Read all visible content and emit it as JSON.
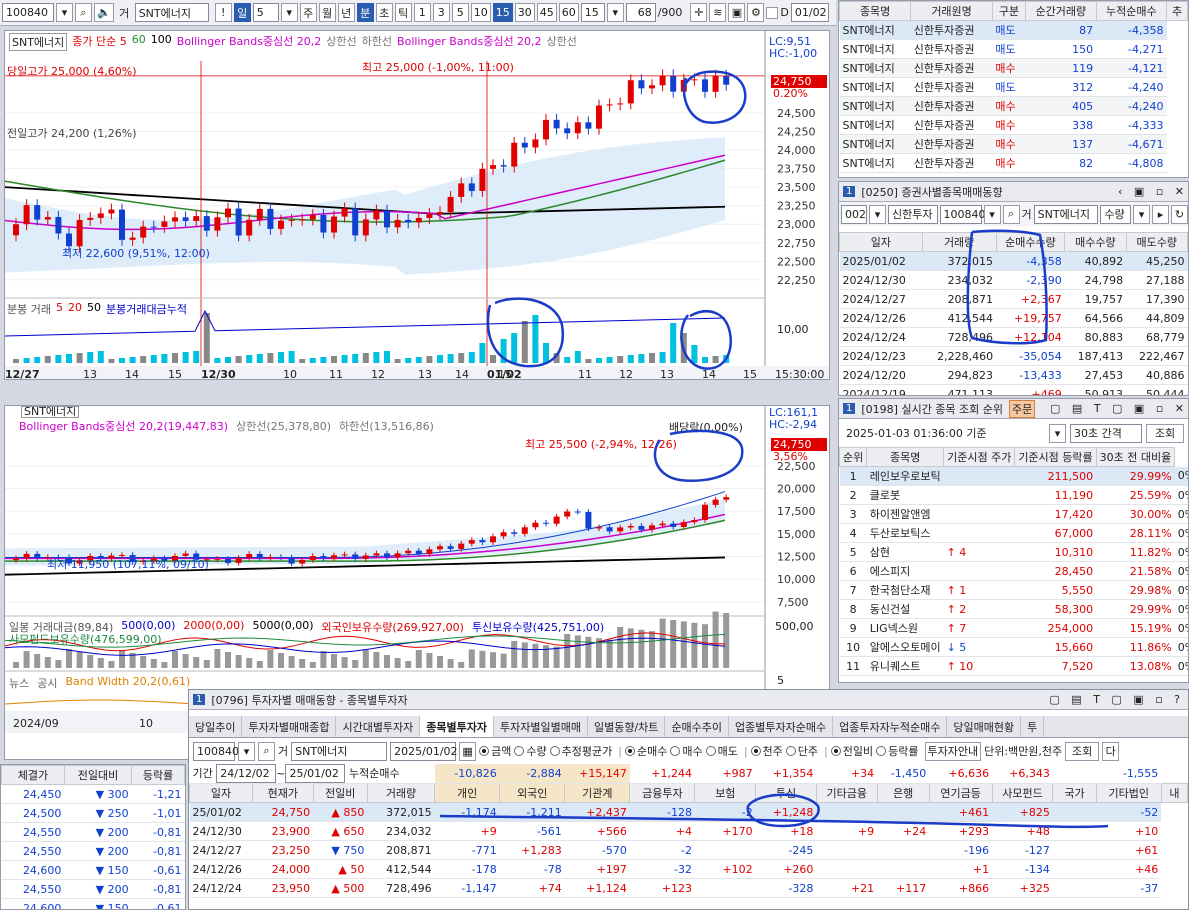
{
  "toolbar": {
    "code": "100840",
    "name_prefix": "거",
    "name": "SNT에너지",
    "period_day": "일",
    "period_num": "5",
    "periods": [
      "주",
      "월",
      "년",
      "분",
      "초",
      "틱"
    ],
    "intervals": [
      "1",
      "3",
      "5",
      "10",
      "15",
      "30",
      "45",
      "60"
    ],
    "interval_value": "15",
    "count": "68",
    "count_total": "/900",
    "date": "01/02",
    "d_label": "D"
  },
  "chart1": {
    "title": "SNT에너지",
    "legend": [
      {
        "text": "종가 단순 5",
        "color": "#e00000"
      },
      {
        "text": "60",
        "color": "#2a8a2a"
      },
      {
        "text": "100",
        "color": "#000000"
      },
      {
        "text": "Bollinger Bands중심선 20,2",
        "color": "#cc00cc"
      },
      {
        "text": "상한선",
        "color": "#777777"
      },
      {
        "text": "하한선",
        "color": "#777777"
      },
      {
        "text": "Bollinger Bands중심선 20,2",
        "color": "#cc00cc"
      },
      {
        "text": "상한선",
        "color": "#777777"
      }
    ],
    "lc": "LC:9,51",
    "hc": "HC:-1,00",
    "price_box": "24,750",
    "pct_box": "0.20%",
    "high_today": "당일고가 25,000 (4,60%)",
    "high_prev": "전일고가 24,200 (1,26%)",
    "max_label": "최고 25,000 (-1,00%, 11:00)",
    "min_label": "최저 22,600 (9,51%, 12:00)",
    "yticks": [
      "24,500",
      "24,250",
      "24,000",
      "23,750",
      "23,500",
      "23,250",
      "23,000",
      "22,750",
      "22,500",
      "22,250"
    ],
    "y_range": [
      22100,
      25200
    ],
    "vol_legend": [
      {
        "text": "분봉 거래",
        "color": "#555555"
      },
      {
        "text": "5",
        "color": "#e00000"
      },
      {
        "text": "20",
        "color": "#e00000"
      },
      {
        "text": "50",
        "color": "#000000"
      },
      {
        "text": "분봉거래대금누적",
        "color": "#0000cc"
      }
    ],
    "vol_tick": "10,00",
    "xlabels": [
      "12/27",
      "13",
      "14",
      "15",
      "12/30",
      "10",
      "11",
      "12",
      "13",
      "14",
      "15",
      "01/02",
      "11",
      "12",
      "13",
      "14",
      "15"
    ],
    "x_right": "15:30:00"
  },
  "chart2": {
    "title": "SNT에너지",
    "legend_line1": "Bollinger Bands중심선 20,2(19,447,83)",
    "legend_upper": "상한선(25,378,80)",
    "legend_lower": "하한선(13,516,86)",
    "lc": "LC:161,1",
    "hc": "HC:-2,94",
    "max_label": "최고 25,500 (-2,94%, 12/26)",
    "min_label": "최저 11,950 (107,11%, 09/10)",
    "dividend": "배당락(0,00%)",
    "price_box": "24,750",
    "pct_box": "3,56%",
    "yticks": [
      "22,500",
      "20,000",
      "17,500",
      "15,000",
      "12,500",
      "10,000",
      "7,500"
    ],
    "y_range": [
      6500,
      26000
    ],
    "vol_legend": [
      {
        "text": "일봉 거래대금(89,84)",
        "color": "#555555"
      },
      {
        "text": "500(0,00)",
        "color": "#0000cc"
      },
      {
        "text": "2000(0,00)",
        "color": "#e00000"
      },
      {
        "text": "5000(0,00)",
        "color": "#000000"
      },
      {
        "text": "외국인보유수량(269,927,00)",
        "color": "#e00000"
      },
      {
        "text": "투신보유수량(425,751,00)",
        "color": "#0000cc"
      }
    ],
    "vol_legend2": "사모펀드보유수량(476,599,00)",
    "vol_ytick": "500,00",
    "bottom_legend": [
      {
        "text": "뉴스",
        "color": "#666666"
      },
      {
        "text": "공시",
        "color": "#666666"
      },
      {
        "text": "Band Width 20,2(0,61)",
        "color": "#e08000"
      }
    ],
    "bottom_tick": "5",
    "xlabels": [
      "2024/09",
      "10"
    ]
  },
  "bottomleft": {
    "headers": [
      "체결가",
      "전일대비",
      "등락률"
    ],
    "rows": [
      [
        "24,450",
        "300",
        "-1,21"
      ],
      [
        "24,500",
        "250",
        "-1,01"
      ],
      [
        "24,550",
        "200",
        "-0,81"
      ],
      [
        "24,550",
        "200",
        "-0,81"
      ],
      [
        "24,600",
        "150",
        "-0,61"
      ],
      [
        "24,550",
        "200",
        "-0,81"
      ],
      [
        "24,600",
        "150",
        "-0,61"
      ]
    ]
  },
  "trades": {
    "headers": [
      "종목명",
      "거래원명",
      "구분",
      "순간거래량",
      "누적순매수",
      "추"
    ],
    "rows": [
      [
        "SNT에너지",
        "신한투자증권",
        "매도",
        "87",
        "-4,358"
      ],
      [
        "SNT에너지",
        "신한투자증권",
        "매도",
        "150",
        "-4,271"
      ],
      [
        "SNT에너지",
        "신한투자증권",
        "매수",
        "119",
        "-4,121"
      ],
      [
        "SNT에너지",
        "신한투자증권",
        "매도",
        "312",
        "-4,240"
      ],
      [
        "SNT에너지",
        "신한투자증권",
        "매수",
        "405",
        "-4,240"
      ],
      [
        "SNT에너지",
        "신한투자증권",
        "매수",
        "338",
        "-4,333"
      ],
      [
        "SNT에너지",
        "신한투자증권",
        "매수",
        "137",
        "-4,671"
      ],
      [
        "SNT에너지",
        "신한투자증권",
        "매수",
        "82",
        "-4,808"
      ]
    ]
  },
  "broker": {
    "num": "1",
    "title": "[0250] 증권사별종목매매동향",
    "code": "002",
    "broker_name": "신한투자",
    "stock_code": "100840",
    "stock_prefix": "거",
    "stock_name": "SNT에너지",
    "mode": "수량",
    "headers": [
      "일자",
      "거래량",
      "순매수수량",
      "매수수량",
      "매도수량"
    ],
    "rows": [
      [
        "2025/01/02",
        "372,015",
        "-4,358",
        "40,892",
        "45,250"
      ],
      [
        "2024/12/30",
        "234,032",
        "-2,390",
        "24,798",
        "27,188"
      ],
      [
        "2024/12/27",
        "208,871",
        "+2,367",
        "19,757",
        "17,390"
      ],
      [
        "2024/12/26",
        "412,544",
        "+19,757",
        "64,566",
        "44,809"
      ],
      [
        "2024/12/24",
        "728,496",
        "+12,104",
        "80,883",
        "68,779"
      ],
      [
        "2024/12/23",
        "2,228,460",
        "-35,054",
        "187,413",
        "222,467"
      ],
      [
        "2024/12/20",
        "294,823",
        "-13,433",
        "27,453",
        "40,886"
      ],
      [
        "2024/12/19",
        "471,113",
        "+469",
        "50,913",
        "50,444"
      ]
    ]
  },
  "rank": {
    "num": "1",
    "title": "[0198] 실시간 종목 조회 순위",
    "tag": "주문",
    "datetime": "2025-01-03 01:36:00 기준",
    "interval": "30초 간격",
    "query_button": "조회",
    "headers": [
      "순위",
      "종목명",
      "기준시점 주가",
      "기준시점 등락률",
      "30초 전 대비율"
    ],
    "rows": [
      [
        "1",
        "레인보우로보틱",
        "",
        "211,500",
        "29.99%",
        "0%"
      ],
      [
        "2",
        "클로봇",
        "",
        "11,190",
        "25.59%",
        "0%"
      ],
      [
        "3",
        "하이젠알앤엠",
        "",
        "17,420",
        "30.00%",
        "0%"
      ],
      [
        "4",
        "두산로보틱스",
        "",
        "67,000",
        "28.11%",
        "0%"
      ],
      [
        "5",
        "삼현",
        "↑ 4",
        "10,310",
        "11.82%",
        "0%"
      ],
      [
        "6",
        "에스피지",
        "",
        "28,450",
        "21.58%",
        "0%"
      ],
      [
        "7",
        "한국첨단소재",
        "↑ 1",
        "5,550",
        "29.98%",
        "0%"
      ],
      [
        "8",
        "동신건설",
        "↑ 2",
        "58,300",
        "29.99%",
        "0%"
      ],
      [
        "9",
        "LIG넥스원",
        "↑ 7",
        "254,000",
        "15.19%",
        "0%"
      ],
      [
        "10",
        "알에스오토메이",
        "↓ 5",
        "15,660",
        "11.86%",
        "0%"
      ],
      [
        "11",
        "유니퀘스트",
        "↑ 10",
        "7,520",
        "13.08%",
        "0%"
      ]
    ]
  },
  "investor": {
    "num": "1",
    "title": "[0796] 투자자별 매매동향 - 종목별투자자",
    "tabs": [
      "당일추이",
      "투자자별매매종합",
      "시간대별투자자",
      "종목별투자자",
      "투자자별일별매매",
      "일별동향/차트",
      "순매수추이",
      "업종별투자자순매수",
      "업종투자자누적순매수",
      "당일매매현황",
      "투"
    ],
    "active_tab": 3,
    "code": "100840",
    "name_prefix": "거",
    "name": "SNT에너지",
    "date": "2025/01/02",
    "radios1": [
      "금액",
      "수량",
      "추정평균가"
    ],
    "radios2": [
      "순매수",
      "매수",
      "매도"
    ],
    "radios3": [
      "천주",
      "단주"
    ],
    "radios4": [
      "전일비",
      "등락률"
    ],
    "investor_button": "투자자안내",
    "unit": "단위:백만원,천주",
    "query_button": "조회",
    "period_label": "기간",
    "period_from": "24/12/02",
    "period_to": "25/01/02",
    "sum_label": "누적순매수",
    "sum_values": [
      "-10,826",
      "-2,884",
      "+15,147",
      "+1,244",
      "+987",
      "+1,354",
      "+34",
      "-1,450",
      "+6,636",
      "+6,343",
      "",
      "-1,555"
    ],
    "headers": [
      "일자",
      "현재가",
      "전일비",
      "거래량",
      "개인",
      "외국인",
      "기관계",
      "금융투자",
      "보험",
      "투신",
      "기타금융",
      "은행",
      "연기금등",
      "사모펀드",
      "국가",
      "기타법인",
      "내"
    ],
    "rows": [
      [
        "25/01/02",
        "24,750",
        "850",
        "372,015",
        "-1,174",
        "-1,211",
        "+2,437",
        "-128",
        "-2",
        "+1,248",
        "",
        "",
        "+461",
        "+825",
        "",
        "-52"
      ],
      [
        "24/12/30",
        "23,900",
        "650",
        "234,032",
        "+9",
        "-561",
        "+566",
        "+4",
        "+170",
        "+18",
        "+9",
        "+24",
        "+293",
        "+48",
        "",
        "+10"
      ],
      [
        "24/12/27",
        "23,250",
        "750",
        "208,871",
        "-771",
        "+1,283",
        "-570",
        "-2",
        "",
        "-245",
        "",
        "",
        "-196",
        "-127",
        "",
        "+61"
      ],
      [
        "24/12/26",
        "24,000",
        "50",
        "412,544",
        "-178",
        "-78",
        "+197",
        "-32",
        "+102",
        "+260",
        "",
        "",
        "+1",
        "-134",
        "",
        "+46"
      ],
      [
        "24/12/24",
        "23,950",
        "500",
        "728,496",
        "-1,147",
        "+74",
        "+1,124",
        "+123",
        "",
        "-328",
        "+21",
        "+117",
        "+866",
        "+325",
        "",
        "-37"
      ]
    ]
  }
}
